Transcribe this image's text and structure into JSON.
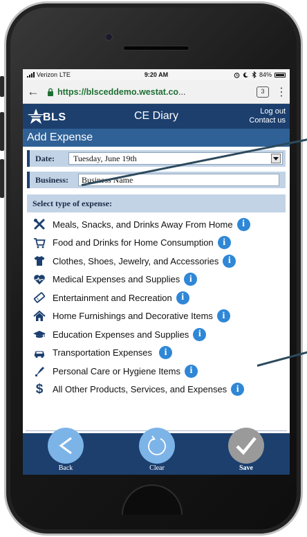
{
  "status_bar": {
    "carrier": "Verizon",
    "network": "LTE",
    "time": "9:20 AM",
    "battery": "84%"
  },
  "browser": {
    "url_host": "https://blsceddemo.westat.co",
    "url_rest": "...",
    "tab_count": "3"
  },
  "header": {
    "logo_text": "BLS",
    "title": "CE Diary",
    "logout_label": "Log out",
    "contact_label": "Contact us"
  },
  "page": {
    "heading": "Add Expense"
  },
  "form": {
    "date_label": "Date:",
    "date_value": "Tuesday, June 19th",
    "business_label": "Business:",
    "business_value": "Business Name",
    "type_header": "Select type of expense:"
  },
  "expense_types": [
    {
      "label": "Meals, Snacks, and Drinks Away From Home",
      "icon": "utensils-icon"
    },
    {
      "label": "Food and Drinks for Home Consumption",
      "icon": "shopping-cart-icon"
    },
    {
      "label": "Clothes, Shoes, Jewelry, and Accessories",
      "icon": "shirt-icon"
    },
    {
      "label": "Medical Expenses and Supplies",
      "icon": "heart-pulse-icon"
    },
    {
      "label": "Entertainment and Recreation",
      "icon": "ticket-icon"
    },
    {
      "label": "Home Furnishings and Decorative Items",
      "icon": "home-icon"
    },
    {
      "label": "Education Expenses and Supplies",
      "icon": "graduation-cap-icon"
    },
    {
      "label": "Transportation Expenses",
      "icon": "car-icon"
    },
    {
      "label": "Personal Care or Hygiene Items",
      "icon": "hair-dryer-icon"
    },
    {
      "label": "All Other Products, Services, and Expenses",
      "icon": "dollar-icon"
    }
  ],
  "bottom_nav": {
    "back_label": "Back",
    "clear_label": "Clear",
    "save_label": "Save"
  },
  "colors": {
    "header_bg": "#1c3f6e",
    "heading_bg": "#2f6197",
    "row_bg": "#c3d3e6",
    "icon_blue": "#1c3f6e",
    "info_blue": "#2f87d6",
    "back_clear_button": "#7db4e8",
    "save_button": "#9a9a9a",
    "url_green": "#1f6f33"
  }
}
